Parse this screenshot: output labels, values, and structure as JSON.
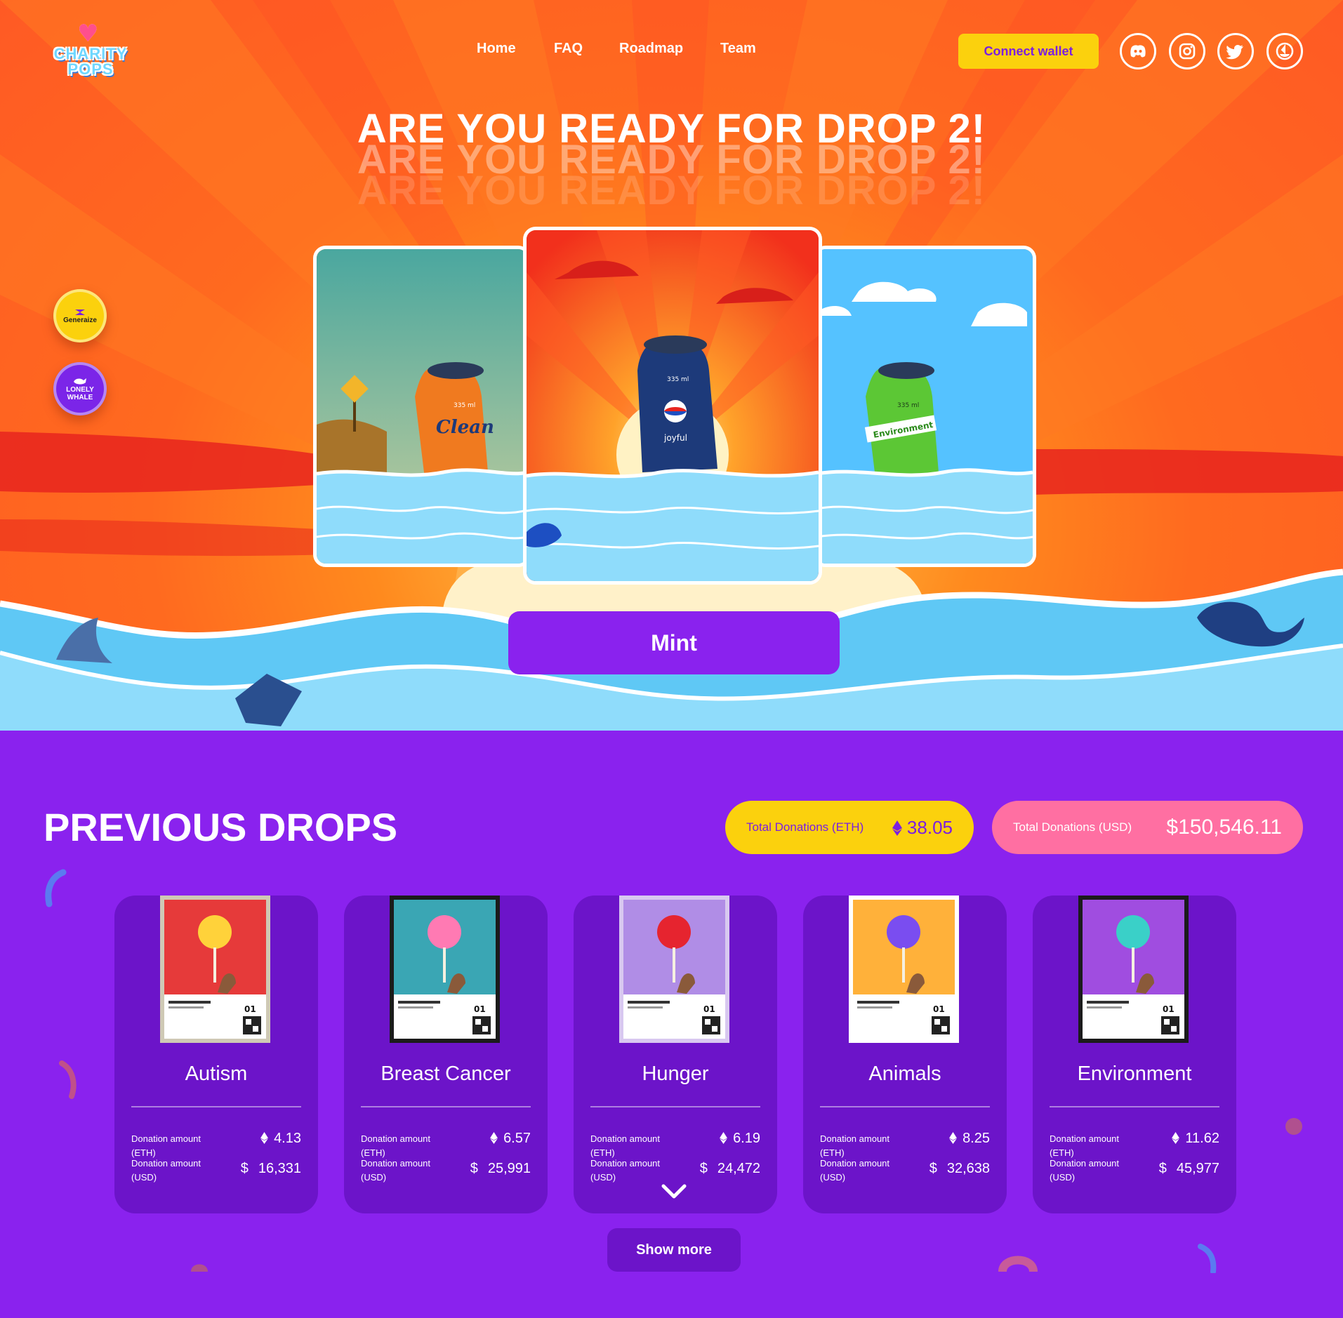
{
  "brand": {
    "logo_text": "CHARITY POPS"
  },
  "nav": {
    "items": [
      "Home",
      "FAQ",
      "Roadmap",
      "Team"
    ]
  },
  "header": {
    "connect_label": "Connect wallet"
  },
  "social": [
    "discord-icon",
    "instagram-icon",
    "twitter-icon",
    "opensea-icon"
  ],
  "hero": {
    "headline": "ARE YOU READY FOR DROP 2!",
    "badges": {
      "generaize": "Generaize",
      "lonely_whale": "LONELY WHALE"
    },
    "cans": [
      {
        "brand": "Clean",
        "volume": "335 ml",
        "color": "#f07a1f"
      },
      {
        "brand": "joyful",
        "volume": "335 ml",
        "color": "#1d3a7a"
      },
      {
        "brand": "Environment",
        "volume": "335 ml",
        "color": "#5cc735"
      }
    ],
    "mint_label": "Mint"
  },
  "drops": {
    "title": "PREVIOUS DROPS",
    "total_eth_label": "Total Donations (ETH)",
    "total_eth_value": "38.05",
    "total_usd_label": "Total Donations (USD)",
    "total_usd_value": "$150,546.11",
    "eth_label": "Donation amount (ETH)",
    "usd_label": "Donation amount (USD)",
    "items": [
      {
        "name": "Autism",
        "eth": "4.13",
        "usd": "16,331",
        "art_bg": "#e63a3a",
        "art_accent": "#ffd23a",
        "frame": "#cfc9b5"
      },
      {
        "name": "Breast Cancer",
        "eth": "6.57",
        "usd": "25,991",
        "art_bg": "#3aa6b4",
        "art_accent": "#ff7ab3",
        "frame": "#1b1b1b"
      },
      {
        "name": "Hunger",
        "eth": "6.19",
        "usd": "24,472",
        "art_bg": "#b08de6",
        "art_accent": "#e6242f",
        "frame": "#d8c8f0"
      },
      {
        "name": "Animals",
        "eth": "8.25",
        "usd": "32,638",
        "art_bg": "#ffb13a",
        "art_accent": "#7a4df0",
        "frame": "#ffffff"
      },
      {
        "name": "Environment",
        "eth": "11.62",
        "usd": "45,977",
        "art_bg": "#a04de0",
        "art_accent": "#3ad0c8",
        "frame": "#1b1b1b"
      }
    ],
    "show_more_label": "Show more"
  },
  "colors": {
    "purple": "#8a22ee",
    "dark_purple": "#6c14c9",
    "yellow": "#fbd10d",
    "pink": "#ff6fa2",
    "orange": "#ff6a1f"
  }
}
